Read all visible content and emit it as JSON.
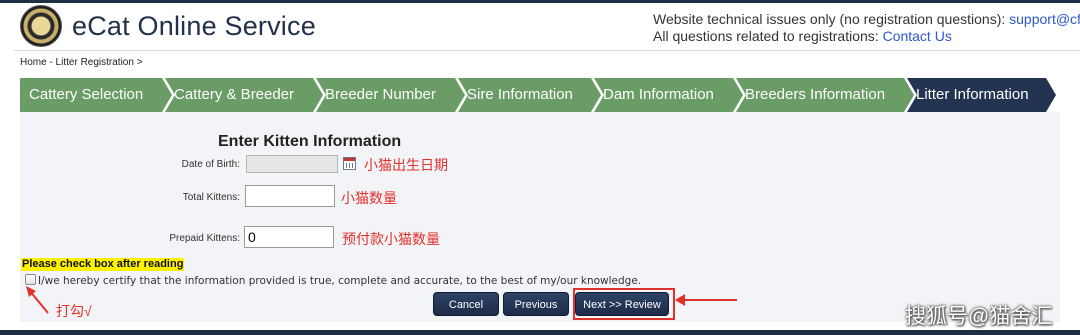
{
  "header": {
    "title": "eCat Online Service",
    "logo_icon": "cfa-seal-logo",
    "support_prefix": "Website technical issues only (no registration questions):",
    "support_email": "support@cfa.c",
    "contact_prefix": "All questions related to registrations:",
    "contact_link": "Contact Us"
  },
  "breadcrumb": "Home - Litter Registration >",
  "steps": [
    {
      "label": "Cattery Selection",
      "active": false
    },
    {
      "label": "Cattery & Breeder",
      "active": false
    },
    {
      "label": "Breeder Number",
      "active": false
    },
    {
      "label": "Sire Information",
      "active": false
    },
    {
      "label": "Dam Information",
      "active": false
    },
    {
      "label": "Breeders Information",
      "active": false
    },
    {
      "label": "Litter Information",
      "active": true
    }
  ],
  "form": {
    "title": "Enter Kitten Information",
    "dob_label": "Date of Birth:",
    "dob_value": "",
    "dob_note": "小猫出生日期",
    "total_label": "Total Kittens:",
    "total_value": "",
    "total_note": "小猫数量",
    "prepaid_label": "Prepaid Kittens:",
    "prepaid_value": "0",
    "prepaid_note": "预付款小猫数量"
  },
  "certification": {
    "warning": "Please check box after reading",
    "text": "I/we hereby certify that the information provided is true, complete and accurate, to the best of my/our knowledge.",
    "checked": false,
    "annotation": "打勾√"
  },
  "buttons": {
    "cancel": "Cancel",
    "previous": "Previous",
    "next": "Next >> Review"
  },
  "watermark": "搜狐号@猫舍汇",
  "colors": {
    "step_green": "#6a9c66",
    "step_active": "#233452",
    "annotation_red": "#e0322b",
    "highlight_yellow": "#fff200",
    "button_navy": "#1d2b47"
  }
}
